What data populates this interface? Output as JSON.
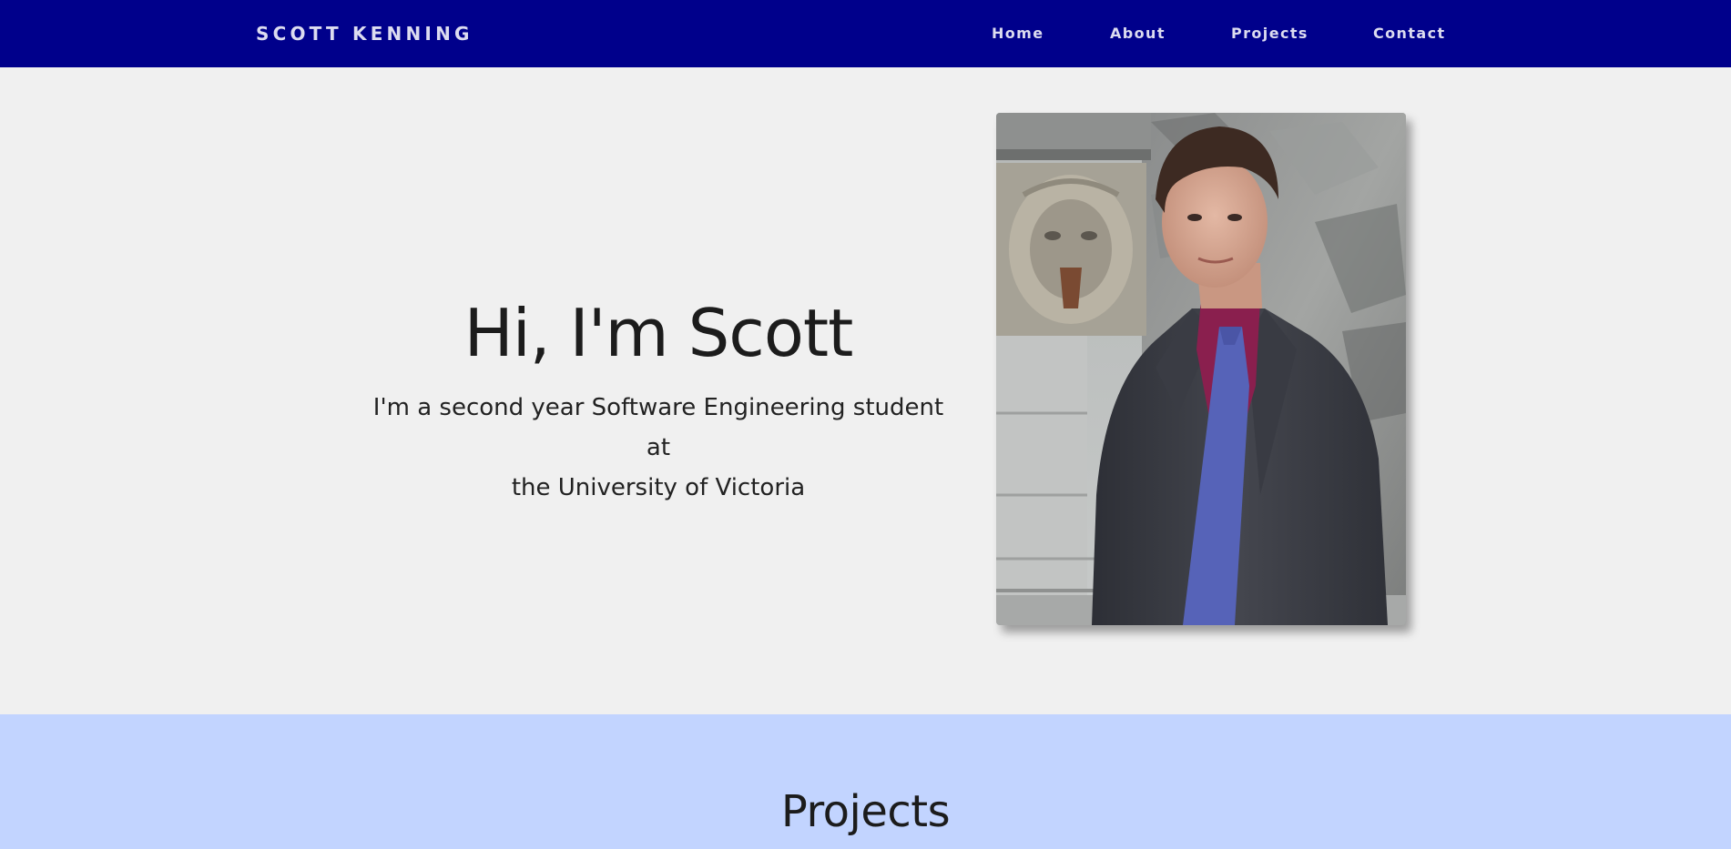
{
  "nav": {
    "brand": "SCOTT KENNING",
    "links": [
      "Home",
      "About",
      "Projects",
      "Contact"
    ]
  },
  "hero": {
    "heading": "Hi, I'm Scott",
    "subtitle_line1": "I'm a second year Software Engineering student at",
    "subtitle_line2": "the University of Victoria"
  },
  "projects": {
    "heading": "Projects"
  },
  "colors": {
    "navbar_bg": "#00008b",
    "nav_text": "#dcdcf0",
    "page_bg": "#f0f0f0",
    "projects_bg": "#c2d4ff"
  }
}
